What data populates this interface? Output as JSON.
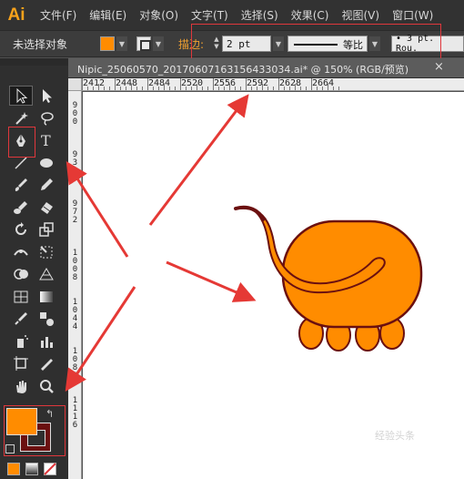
{
  "app": {
    "logo": "Ai"
  },
  "menu": [
    "文件(F)",
    "编辑(E)",
    "对象(O)",
    "文字(T)",
    "选择(S)",
    "效果(C)",
    "视图(V)",
    "窗口(W)"
  ],
  "control_bar": {
    "selection_status": "未选择对象",
    "fill_color": "#ff8c00",
    "stroke_label": "描边:",
    "stroke_weight": "2 pt",
    "profile_label": "等比",
    "brush": "• 3 pt. Rou."
  },
  "document": {
    "tab_title": "Nipic_25060570_20170607163156433034.ai* @ 150% (RGB/预览)",
    "close": "×"
  },
  "ruler_top": [
    "2412",
    "2448",
    "2484",
    "2520",
    "2556",
    "2592",
    "2628",
    "2664"
  ],
  "ruler_left": [
    [
      "9",
      "0",
      "0"
    ],
    [
      "9",
      "3",
      "6"
    ],
    [
      "9",
      "7",
      "2"
    ],
    [
      "1",
      "0",
      "0",
      "8"
    ],
    [
      "1",
      "0",
      "4",
      "4"
    ],
    [
      "1",
      "0",
      "8",
      "0"
    ],
    [
      "1",
      "1",
      "1",
      "6"
    ]
  ],
  "colors": {
    "accent": "#f7a21b",
    "fill": "#ff8c00",
    "stroke": "#6b1010",
    "highlight": "#e0373c"
  },
  "tools": [
    "selection-tool",
    "direct-selection-tool",
    "magic-wand-tool",
    "lasso-tool",
    "pen-tool",
    "type-tool",
    "line-segment-tool",
    "ellipse-tool",
    "paintbrush-tool",
    "pencil-tool",
    "blob-brush-tool",
    "eraser-tool",
    "rotate-tool",
    "scale-tool",
    "width-tool",
    "free-transform-tool",
    "shape-builder-tool",
    "perspective-grid-tool",
    "mesh-tool",
    "gradient-tool",
    "eyedropper-tool",
    "blend-tool",
    "symbol-sprayer-tool",
    "column-graph-tool",
    "artboard-tool",
    "slice-tool",
    "hand-tool",
    "zoom-tool"
  ],
  "watermark": "经验头条"
}
